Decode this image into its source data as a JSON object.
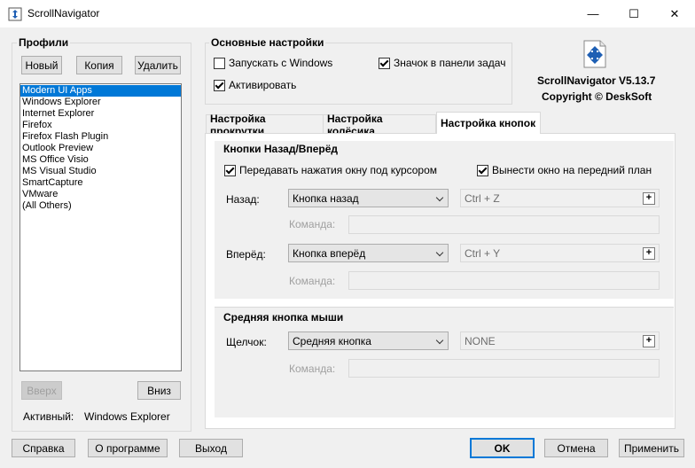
{
  "window": {
    "title": "ScrollNavigator",
    "minimize_glyph": "—",
    "maximize_glyph": "☐",
    "close_glyph": "✕"
  },
  "profiles": {
    "label": "Профили",
    "new_button": "Новый",
    "copy_button": "Копия",
    "delete_button": "Удалить",
    "items": [
      "Modern UI Apps",
      "Windows Explorer",
      "Internet Explorer",
      "Firefox",
      "Firefox Flash Plugin",
      "Outlook Preview",
      "MS Office Visio",
      "MS Visual Studio",
      "SmartCapture",
      "VMware",
      "(All Others)"
    ],
    "selected_index": 0,
    "up_button": "Вверх",
    "down_button": "Вниз",
    "active_label": "Активный:",
    "active_value": "Windows Explorer"
  },
  "main_settings": {
    "label": "Основные настройки",
    "start_with_windows": {
      "label": "Запускать с Windows",
      "checked": false
    },
    "tray_icon": {
      "label": "Значок в панели задач",
      "checked": true
    },
    "activate": {
      "label": "Активировать",
      "checked": true
    }
  },
  "about": {
    "version": "ScrollNavigator V5.13.7",
    "copyright": "Copyright © DeskSoft"
  },
  "tabs": [
    "Настройка прокрутки",
    "Настройка колёсика",
    "Настройка кнопок"
  ],
  "active_tab": 2,
  "back_forward": {
    "label": "Кнопки Назад/Вперёд",
    "pass_to_window": {
      "label": "Передавать нажатия окну под курсором",
      "checked": true
    },
    "bring_to_front": {
      "label": "Вынести окно на передний план",
      "checked": true
    },
    "back": {
      "label": "Назад:",
      "action": "Кнопка назад",
      "shortcut": "Ctrl + Z",
      "command_label": "Команда:",
      "command_value": ""
    },
    "forward": {
      "label": "Вперёд:",
      "action": "Кнопка вперёд",
      "shortcut": "Ctrl + Y",
      "command_label": "Команда:",
      "command_value": ""
    }
  },
  "middle": {
    "label": "Средняя кнопка мыши",
    "click": {
      "label": "Щелчок:",
      "action": "Средняя кнопка",
      "shortcut": "NONE",
      "command_label": "Команда:",
      "command_value": ""
    }
  },
  "plus_glyph": "+",
  "footer": {
    "help": "Справка",
    "about": "О программе",
    "exit": "Выход",
    "ok": "OK",
    "cancel": "Отмена",
    "apply": "Применить"
  },
  "colors": {
    "accent": "#0078d7",
    "selection": "#0078d7",
    "background": "#f0f0f0"
  }
}
